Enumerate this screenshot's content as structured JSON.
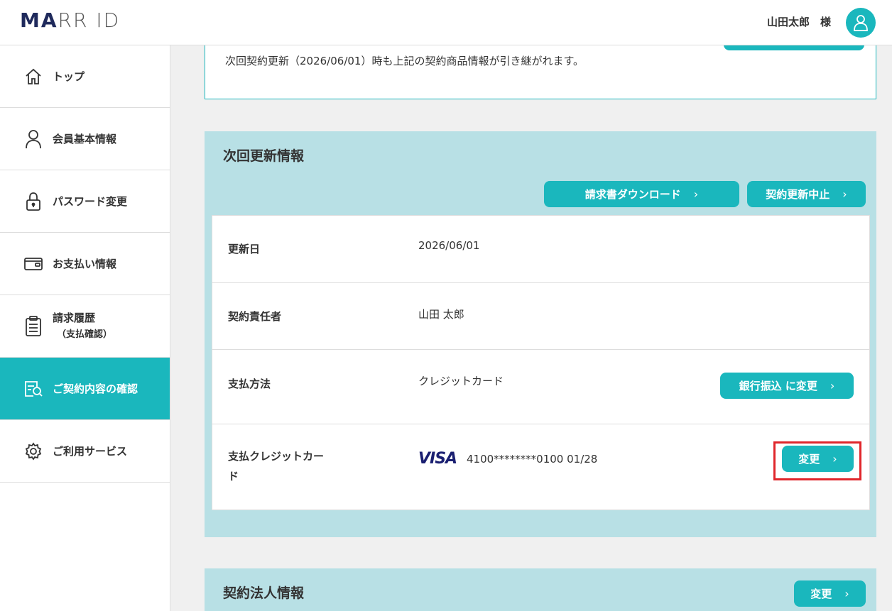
{
  "header": {
    "logo_accent": "MA",
    "logo_rest": "RR ID",
    "user_name": "山田太郎　様"
  },
  "sidebar": {
    "items": [
      {
        "label": "トップ",
        "icon": "home-icon"
      },
      {
        "label": "会員基本情報",
        "icon": "user-icon"
      },
      {
        "label": "パスワード変更",
        "icon": "lock-icon"
      },
      {
        "label": "お支払い情報",
        "icon": "wallet-icon"
      },
      {
        "label": "請求履歴",
        "sub": "（支払確認）",
        "icon": "clipboard-icon"
      },
      {
        "label": "ご契約内容の確認",
        "icon": "document-search-icon",
        "active": true
      },
      {
        "label": "ご利用サービス",
        "icon": "gear-icon"
      }
    ]
  },
  "notice": {
    "text": "次回契約更新（2026/06/01）時も上記の契約商品情報が引き継がれます。"
  },
  "renewal": {
    "title": "次回更新情報",
    "download_label": "請求書ダウンロード",
    "stop_label": "契約更新中止",
    "rows": {
      "renew_date": {
        "key": "更新日",
        "value": "2026/06/01"
      },
      "owner": {
        "key": "契約責任者",
        "value": "山田 太郎"
      },
      "payment": {
        "key": "支払方法",
        "value": "クレジットカード",
        "button": "銀行振込 に変更"
      },
      "card": {
        "key_line1": "支払クレジットカー",
        "key_line2": "ド",
        "brand": "VISA",
        "number": "4100********0100 01/28",
        "button": "変更"
      }
    }
  },
  "corp": {
    "title": "契約法人情報",
    "change_label": "変更"
  },
  "colors": {
    "accent": "#1ab7bd",
    "panel_bg": "#b8e0e5",
    "highlight": "#e0262b"
  }
}
